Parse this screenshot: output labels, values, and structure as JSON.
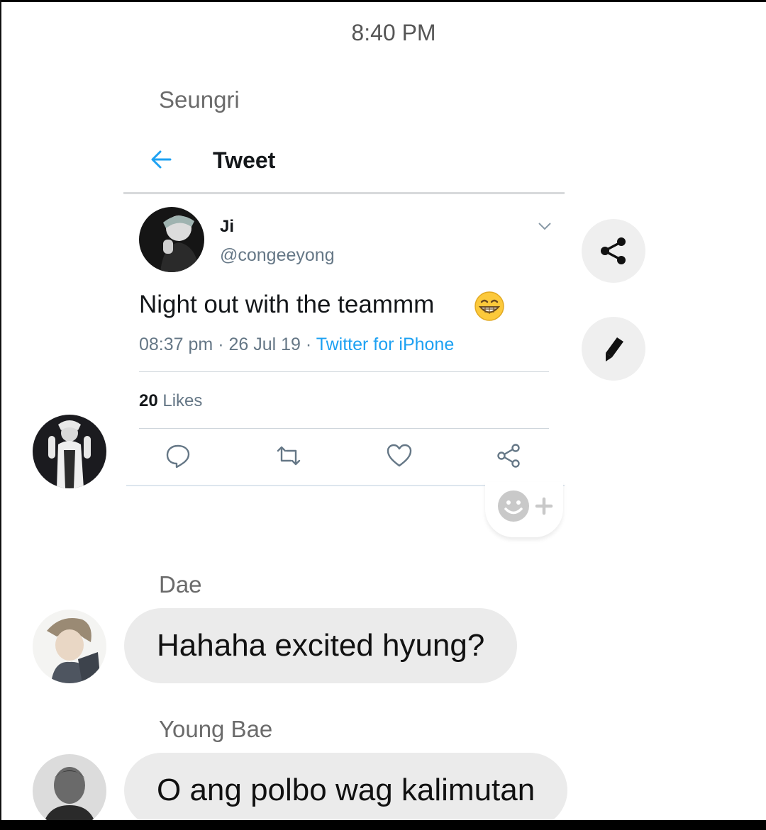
{
  "status": {
    "time": "8:40 PM"
  },
  "messages": [
    {
      "sender": "Seungri",
      "tweet": {
        "header_title": "Tweet",
        "author_name": "Ji",
        "author_handle": "@congeeyong",
        "text": "Night out with the teammm",
        "emoji": "grinning-face-emoji",
        "time": "08:37 pm",
        "date": "26 Jul 19",
        "source": "Twitter for iPhone",
        "likes_count": "20",
        "likes_label": "Likes",
        "actions": [
          "reply-icon",
          "retweet-icon",
          "like-icon",
          "share-icon"
        ]
      }
    },
    {
      "sender": "Dae",
      "text": "Hahaha excited hyung?"
    },
    {
      "sender": "Young Bae",
      "text": "O ang polbo wag kalimutan"
    }
  ],
  "side_actions": [
    "share-icon",
    "edit-icon"
  ],
  "colors": {
    "twitter_blue": "#1da1f2",
    "bubble_bg": "#ebebeb",
    "muted_text": "#657786"
  }
}
